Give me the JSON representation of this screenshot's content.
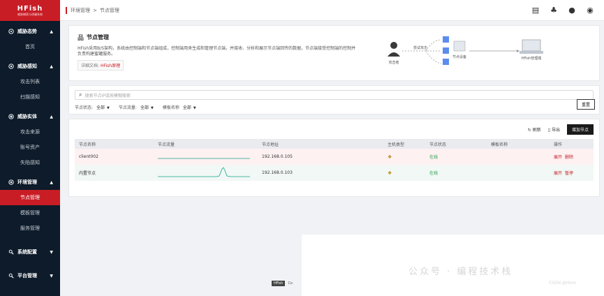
{
  "logo": {
    "title": "HFish",
    "subtitle": "威胁捕获与诱骗系统"
  },
  "sidebar": {
    "groups": [
      {
        "label": "威胁态势",
        "icon": "radar-icon",
        "items": [
          "首页"
        ]
      },
      {
        "label": "威胁感知",
        "icon": "eye-icon",
        "items": [
          "攻击列表",
          "扫描感知"
        ]
      },
      {
        "label": "威胁实体",
        "icon": "target-icon",
        "items": [
          "攻击来源",
          "账号资产",
          "失陷感知"
        ]
      },
      {
        "label": "环境管理",
        "icon": "settings-icon",
        "items": [
          "节点管理",
          "模板管理",
          "服务管理"
        ]
      },
      {
        "label": "系统配置",
        "icon": "config-icon",
        "items": []
      },
      {
        "label": "平台管理",
        "icon": "platform-icon",
        "items": []
      }
    ],
    "active": "节点管理"
  },
  "breadcrumb": [
    "环境管理",
    "节点管理"
  ],
  "intro": {
    "title": "节点管理",
    "desc": "HFish采用B/S架构，系统由控制端和节点端组成，控制端用来生成和管理节点端，并接收、分析和展示节点端回传的数据，节点端接受控制端的控制并负责构建蜜罐服务。",
    "doc_label": "详细文档:",
    "doc_link": "HFish原理"
  },
  "diagram": {
    "attacker": "攻击者",
    "probe": "尝试攻击",
    "node": "节点设备",
    "console": "HFish管理端"
  },
  "filter": {
    "search_placeholder": "搜索节点IP或按模糊搜索",
    "status_label": "节点状态:",
    "status_value": "全部",
    "traffic_label": "节点流量:",
    "traffic_value": "全部",
    "template_label": "模板名称",
    "template_value": "全部",
    "reset": "重置"
  },
  "table": {
    "refresh": "刷新",
    "export": "导出",
    "add": "增加节点",
    "headers": [
      "节点名称",
      "节点流量",
      "节点地址",
      "主机类型",
      "节点状态",
      "模板名称",
      "操作"
    ],
    "rows": [
      {
        "name": "client002",
        "ip": "192.168.0.105",
        "status": "在线",
        "template": "",
        "actions": [
          "展开",
          "删除"
        ],
        "traffic": "flat"
      },
      {
        "name": "内置节点",
        "ip": "192.168.0.103",
        "status": "在线",
        "template": "",
        "actions": [
          "展开",
          "暂停"
        ],
        "traffic": "spike"
      }
    ]
  },
  "footer": {
    "badge": "HFish",
    "text": "Co"
  },
  "watermark": {
    "text": "公众号 · 编程技术栈",
    "sub": "CSDN @Hom"
  },
  "colors": {
    "accent": "#c81d25",
    "sidebar": "#0d1b2a",
    "online": "#2a9d4a",
    "traffic": "#17a589"
  }
}
